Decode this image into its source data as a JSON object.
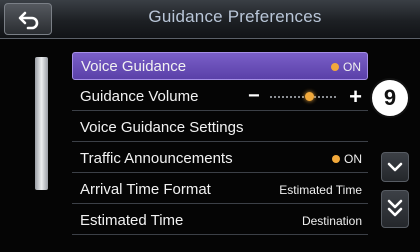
{
  "header": {
    "title": "Guidance Preferences",
    "back_icon": "back-arrow-icon"
  },
  "menu": {
    "items": [
      {
        "label": "Voice Guidance",
        "value": "ON",
        "indicator": "orange-dot",
        "selected": true
      },
      {
        "label": "Guidance Volume",
        "control": "volume-slider"
      },
      {
        "label": "Voice Guidance Settings"
      },
      {
        "label": "Traffic Announcements",
        "value": "ON",
        "indicator": "orange-dot"
      },
      {
        "label": "Arrival Time Format",
        "value": "Estimated Time"
      },
      {
        "label": "Estimated Time",
        "value": "Destination"
      }
    ]
  },
  "volume": {
    "minus": "−",
    "plus": "+",
    "level": 0.6
  },
  "callout": {
    "number": "9"
  },
  "colors": {
    "accent_orange": "#f2a93b",
    "selection_purple": "#6a50b8",
    "title_blue": "#b9c6d8"
  }
}
